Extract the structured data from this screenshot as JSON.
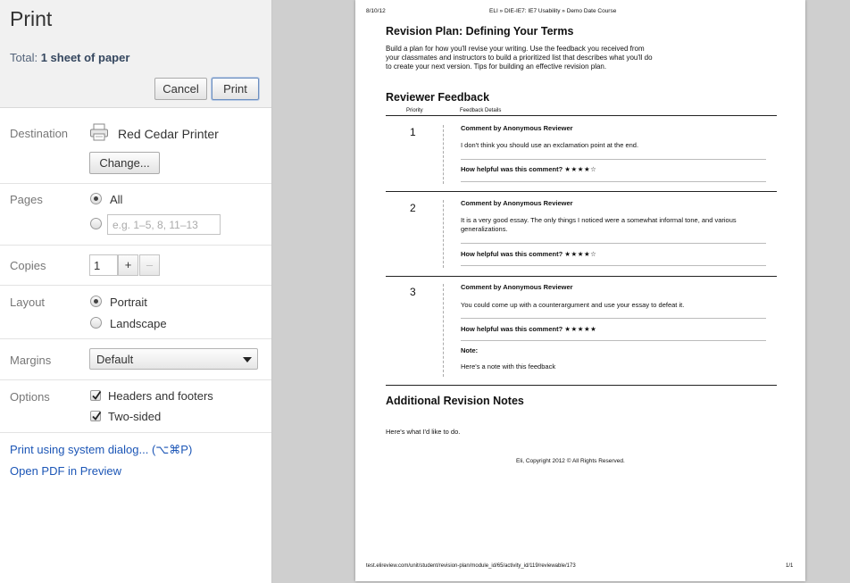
{
  "header": {
    "title": "Print",
    "total_label": "Total:",
    "total_value": "1 sheet of paper",
    "cancel_label": "Cancel",
    "print_label": "Print"
  },
  "destination": {
    "label": "Destination",
    "printer": "Red Cedar Printer",
    "change_label": "Change...",
    "icon": "printer-icon"
  },
  "pages": {
    "label": "Pages",
    "all_label": "All",
    "selected": "all",
    "range_placeholder": "e.g. 1–5, 8, 11–13"
  },
  "copies": {
    "label": "Copies",
    "value": "1",
    "plus": "+",
    "minus": "–"
  },
  "layout": {
    "label": "Layout",
    "portrait_label": "Portrait",
    "landscape_label": "Landscape",
    "selected": "portrait"
  },
  "margins": {
    "label": "Margins",
    "value": "Default"
  },
  "options": {
    "label": "Options",
    "headers_footers_label": "Headers and footers",
    "headers_footers_checked": true,
    "two_sided_label": "Two-sided",
    "two_sided_checked": true
  },
  "links": {
    "system_dialog": "Print using system dialog... (⌥⌘P)",
    "open_pdf": "Open PDF in Preview"
  },
  "preview": {
    "header_date": "8/10/12",
    "header_title": "ELI » DIE-IE7: IE7 Usability » Demo Date Course",
    "doc_title": "Revision Plan: Defining Your Terms",
    "intro": "Build a plan for how you'll revise your writing. Use the feedback you received from your classmates and instructors to build a prioritized list that describes what you'll do to create your next version. Tips for building an effective revision plan.",
    "feedback_heading": "Reviewer Feedback",
    "col_priority": "Priority",
    "col_details": "Feedback Details",
    "feedback": [
      {
        "priority": "1",
        "author": "Comment by Anonymous Reviewer",
        "text": "I don't think you should use an exclamation point at the end.",
        "helpful_label": "How helpful was this comment?",
        "stars": "★★★★☆"
      },
      {
        "priority": "2",
        "author": "Comment by Anonymous Reviewer",
        "text": "It is a very good essay. The only things I noticed were a somewhat informal tone, and various generalizations.",
        "helpful_label": "How helpful was this comment?",
        "stars": "★★★★☆"
      },
      {
        "priority": "3",
        "author": "Comment by Anonymous Reviewer",
        "text": "You could come up with a counterargument and use your essay to defeat it.",
        "helpful_label": "How helpful was this comment?",
        "stars": "★★★★★",
        "note_label": "Note:",
        "note_text": "Here's a note with this feedback"
      }
    ],
    "additional_heading": "Additional Revision Notes",
    "additional_text": "Here's what I'd like to do.",
    "copyright": "Eli, Copyright 2012 © All Rights Reserved.",
    "footer_url": "test.elireview.com/unit/student/revision-plan/module_id/65/activity_id/119/reviewable/173",
    "footer_page": "1/1"
  }
}
